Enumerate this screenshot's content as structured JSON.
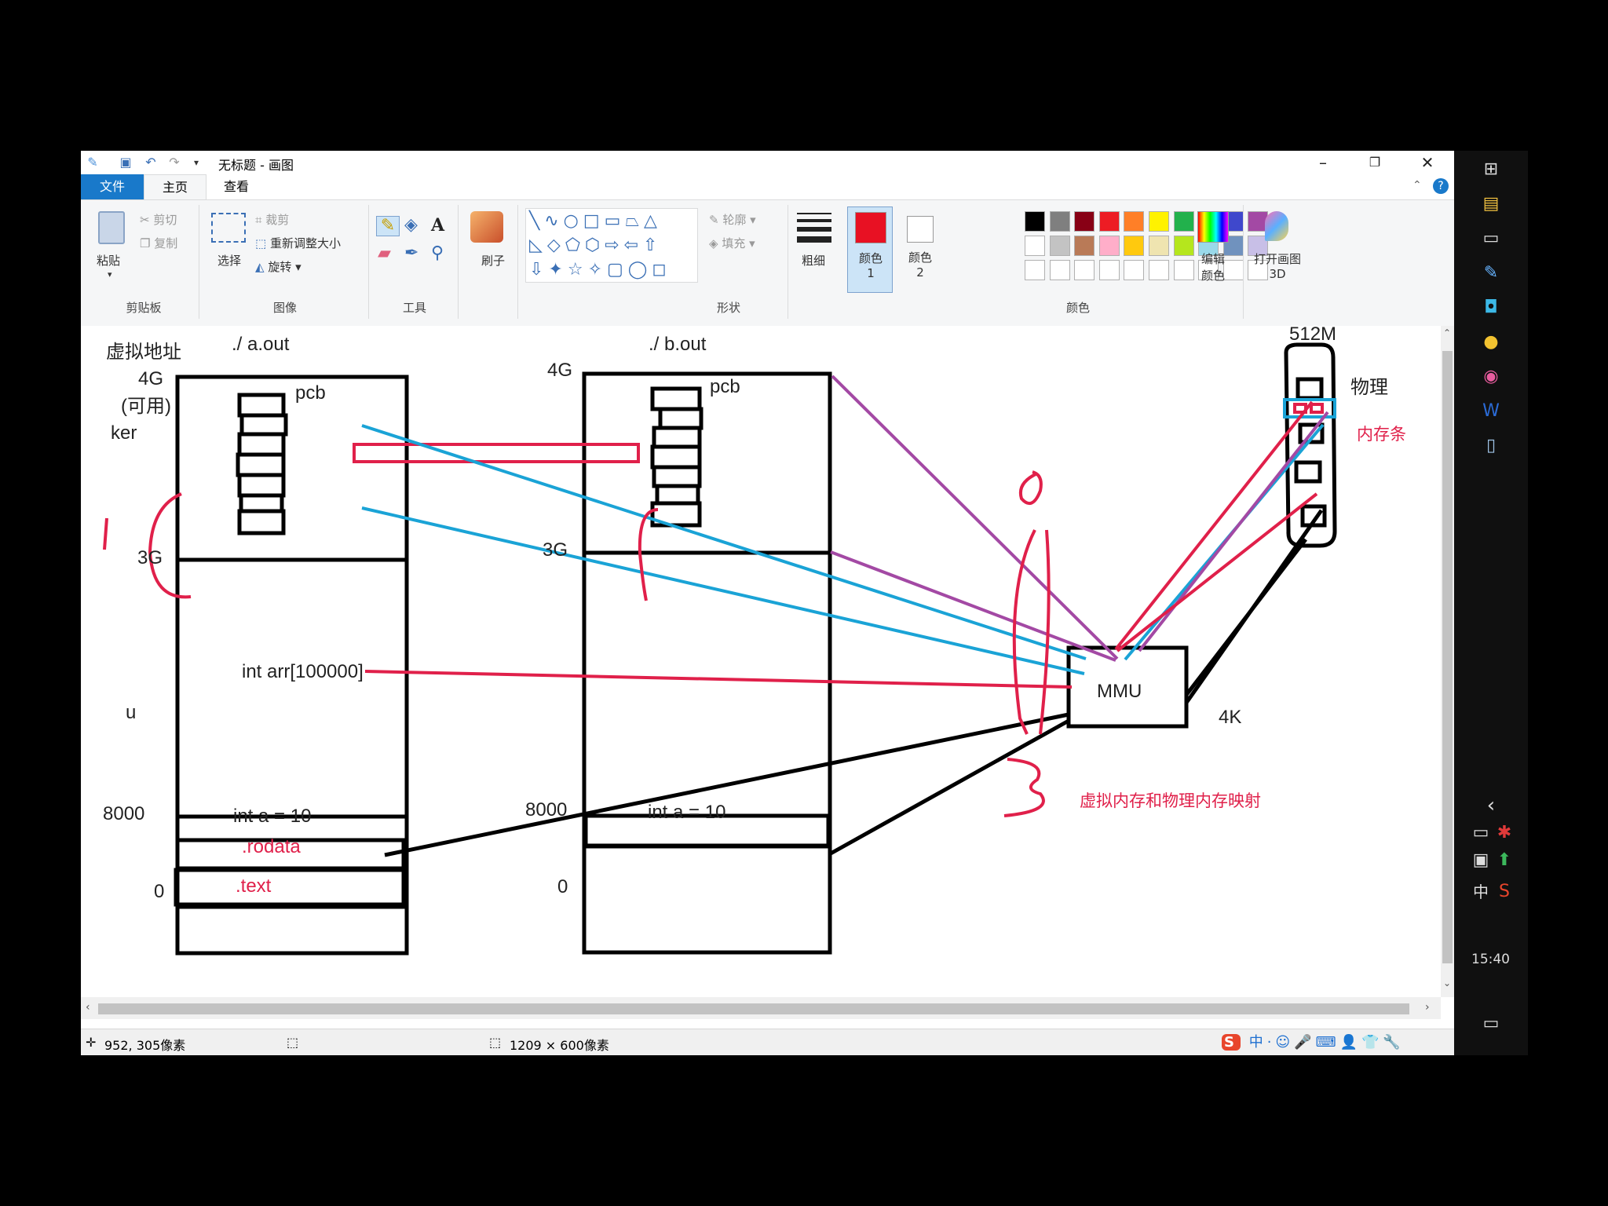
{
  "window": {
    "title": "无标题 - 画图",
    "tabs": [
      "文件",
      "主页",
      "查看"
    ]
  },
  "ribbon": {
    "clipboard": {
      "paste": "粘贴",
      "cut": "剪切",
      "copy": "复制",
      "group": "剪贴板"
    },
    "image": {
      "select": "选择",
      "crop": "裁剪",
      "resize": "重新调整大小",
      "rotate": "旋转",
      "group": "图像"
    },
    "tools": {
      "group": "工具"
    },
    "brush": {
      "label": "刷子"
    },
    "shapes": {
      "outline": "轮廓",
      "fill": "填充",
      "group": "形状"
    },
    "size": {
      "label": "粗细"
    },
    "color1": {
      "label": "颜色 1",
      "value": "#e81123"
    },
    "color2": {
      "label": "颜色 2",
      "value": "#ffffff"
    },
    "colors": {
      "group": "颜色",
      "edit": "编辑颜色",
      "palette_row1": [
        "#000000",
        "#7f7f7f",
        "#880015",
        "#ed1c24",
        "#ff7f27",
        "#fff200",
        "#22b14c",
        "#00a2e8",
        "#3f48cc",
        "#a349a4"
      ],
      "palette_row2": [
        "#ffffff",
        "#c3c3c3",
        "#b97a57",
        "#ffaec9",
        "#ffc90e",
        "#efe4b0",
        "#b5e61d",
        "#99d9ea",
        "#7092be",
        "#c8bfe7"
      ]
    },
    "paint3d": {
      "label": "打开画图 3D"
    }
  },
  "canvas": {
    "labels": {
      "vaddr": "虚拟地址",
      "aout": "./  a.out",
      "bout": "./  b.out",
      "a_4g": "4G",
      "a_avail": "(可用)",
      "ker": "ker",
      "a_pcb": "pcb",
      "a_3g": "3G",
      "arr": "int arr[100000]",
      "u": "u",
      "a_8000": "8000",
      "a_int": "int a = 10",
      "rodata": ".rodata",
      "text": ".text",
      "a_0": "0",
      "b_4g": "4G",
      "b_pcb": "pcb",
      "b_3g": "3G",
      "b_8000": "8000",
      "b_int": "int a = 10",
      "b_0": "0",
      "mmu": "MMU",
      "k4": "4K",
      "m512": "512M",
      "phys": "物理",
      "memstick": "内存条",
      "mapping": "虚拟内存和物理内存映射"
    }
  },
  "status": {
    "cursor": "952, 305像素",
    "size": "1209 × 600像素"
  },
  "taskbar": {
    "ime": "中",
    "time": "15:40"
  }
}
